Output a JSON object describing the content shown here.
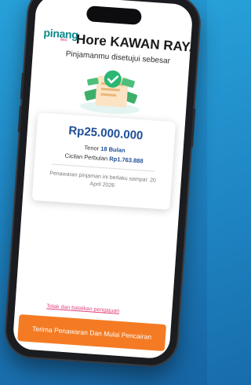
{
  "brand": {
    "logo_text": "pinang",
    "logo_sub": "flexi"
  },
  "header": {
    "title": "Hore KAWAN RAYA!",
    "subtitle": "Pinjamanmu disetujui sebesar"
  },
  "loan_card": {
    "amount": "Rp25.000.000",
    "tenor_label": "Tenor",
    "tenor_value": "18 Bulan",
    "installment_label": "Cicilan Perbulan",
    "installment_value": "Rp1.763.888",
    "offer_note": "Penawaran pinjaman ini berlaku sampai: 20 April 2026"
  },
  "actions": {
    "reject_link": "Tolak dan batalkan pengajuan",
    "accept_button": "Terima Penawaran Dan Mulai Pencairan"
  },
  "colors": {
    "background": "#1f86c4",
    "amount": "#1f4e96",
    "accept_button": "#f47b23",
    "reject_link": "#e2447e",
    "logo": "#0b8a8a",
    "check_badge": "#2bb673"
  },
  "icons": {
    "illustration": "approved-document-money-icon",
    "check": "check-circle-icon"
  }
}
